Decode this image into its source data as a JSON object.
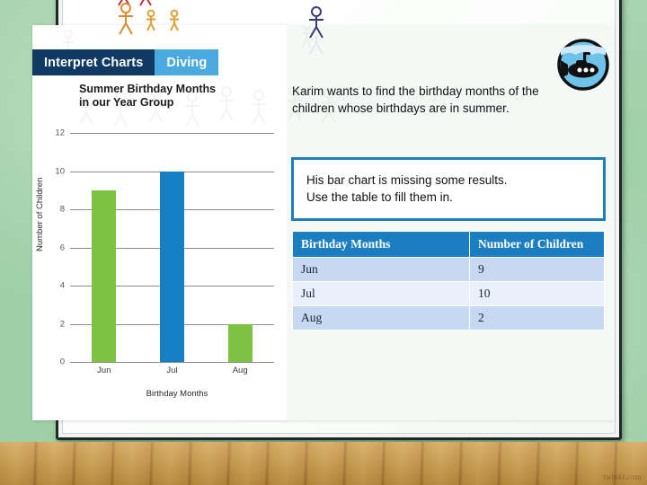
{
  "tabs": [
    {
      "label": "Interpret Charts",
      "state": "active",
      "color": "#103a63"
    },
    {
      "label": "Diving",
      "state": "inactive",
      "color": "#4aaae0"
    }
  ],
  "badge": {
    "icon": "submarine-icon",
    "circle_color": "#4aaae0"
  },
  "intro_text": "Karim wants to find the birthday months of the children whose birthdays are in summer.",
  "callout": {
    "line1": "His bar chart is missing some results.",
    "line2": "Use the table to fill them in.",
    "border_color": "#1f7cbd"
  },
  "table": {
    "headers": [
      "Birthday Months",
      "Number of Children"
    ],
    "rows": [
      {
        "month": "Jun",
        "children": "9"
      },
      {
        "month": "Jul",
        "children": "10"
      },
      {
        "month": "Aug",
        "children": "2"
      }
    ],
    "header_color": "#1b7ec0",
    "row_odd_color": "#c6d9f1",
    "row_even_color": "#e9f0fb"
  },
  "watermark": "twinkl.com",
  "chart_data": {
    "type": "bar",
    "title": "Summer Birthday Months in our Year Group",
    "title_line1": "Summer Birthday Months",
    "title_line2": "in our Year Group",
    "xlabel": "Birthday Months",
    "ylabel": "Number of Children",
    "categories": [
      "Jun",
      "Jul",
      "Aug"
    ],
    "values": [
      9,
      10,
      2
    ],
    "colors": [
      "#7dc242",
      "#1580c4",
      "#7dc242"
    ],
    "ylim": [
      0,
      12
    ],
    "yticks": [
      0,
      2,
      4,
      6,
      8,
      10,
      12
    ],
    "grid": true,
    "legend": "none"
  }
}
